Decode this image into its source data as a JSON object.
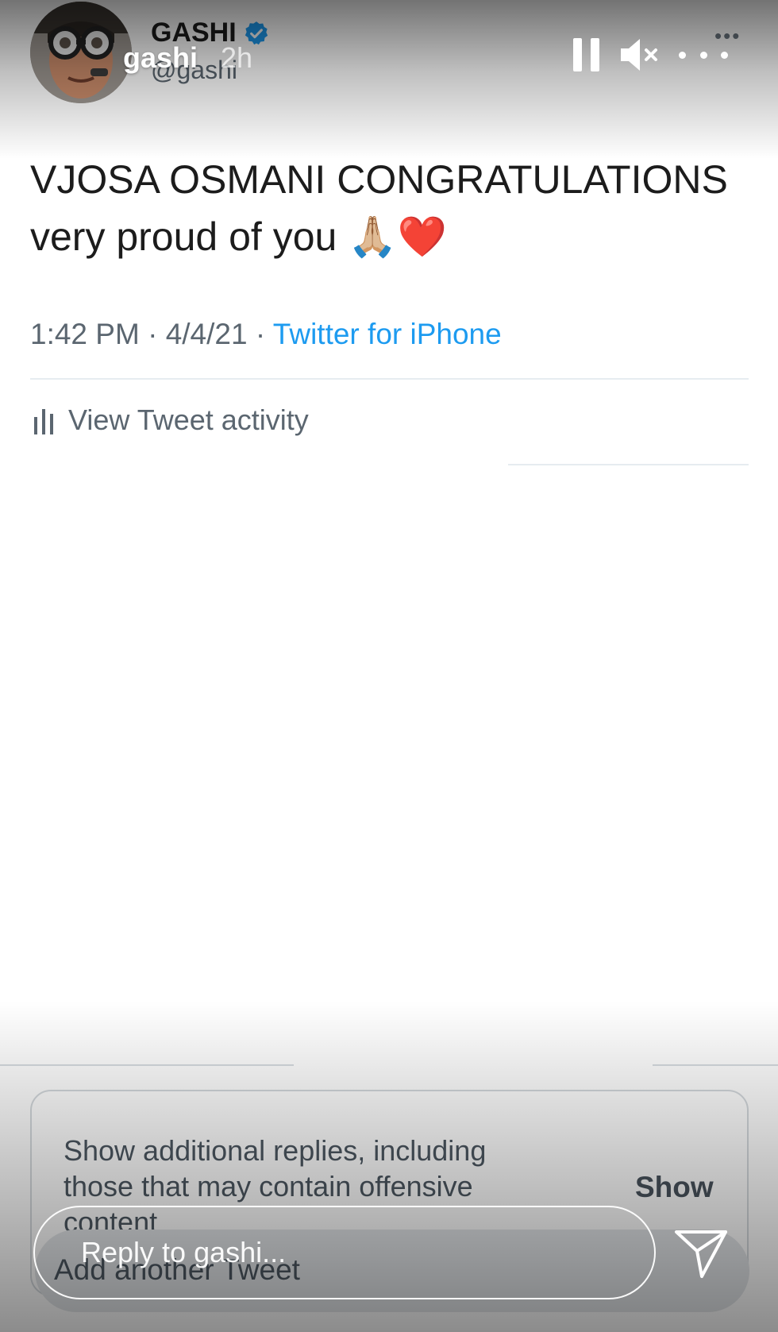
{
  "tweet": {
    "display_name": "GASHI",
    "handle": "@gashi",
    "more_icon": "ellipsis-icon",
    "text_line1": "VJOSA OSMANI CONGRATULATIONS",
    "text_line2": "very proud of you 🙏🏼❤️",
    "time": "1:42 PM",
    "date": "4/4/21",
    "separator": "·",
    "source": "Twitter for iPhone",
    "activity_label": "View Tweet activity",
    "replies_notice": "Show additional replies, including those that may contain offensive content",
    "show_label": "Show",
    "add_tweet_label": "Add another Tweet"
  },
  "story": {
    "username": "gashi",
    "time_ago": "2h",
    "reply_placeholder": "Reply to gashi...",
    "icons": [
      "pause-icon",
      "mute-icon",
      "more-dots-icon",
      "send-icon"
    ]
  },
  "colors": {
    "link_blue": "#1d9bf0",
    "verified_blue": "#1d9bf0",
    "text_dark": "#1c1c1c",
    "text_muted": "#5b6670"
  }
}
